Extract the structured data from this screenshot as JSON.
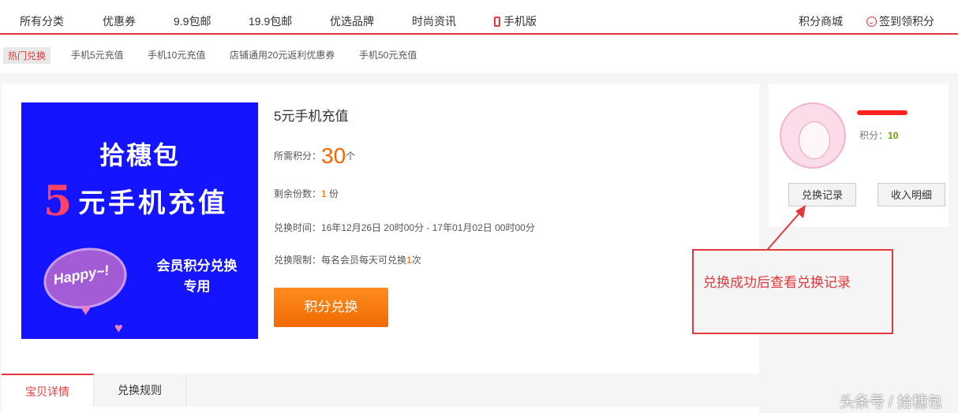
{
  "topnav": {
    "items": [
      "所有分类",
      "优惠券",
      "9.9包邮",
      "19.9包邮",
      "优选品牌",
      "时尚资讯"
    ],
    "mobile": "手机版",
    "points_mall": "积分商城",
    "signin": "签到领积分"
  },
  "subnav": {
    "items": [
      "热门兑换",
      "手机5元充值",
      "手机10元充值",
      "店铺通用20元返利优惠券",
      "手机50元充值"
    ]
  },
  "product": {
    "image_text": {
      "line1": "拾穗包",
      "line2_num": "5",
      "line2": "元手机充值",
      "line3": "会员积分兑换",
      "line4": "专用",
      "bubble": "Happy~!"
    },
    "title": "5元手机充值",
    "points_label": "所需积分：",
    "points_value": "30",
    "points_unit": "个",
    "remaining_label": "剩余份数：",
    "remaining_value": "1",
    "remaining_unit": " 份",
    "time_label": "兑换时间：",
    "time_value": "16年12月26日 20时00分 - 17年01月02日 00时00分",
    "limit_label": "兑换限制：",
    "limit_pre": "每名会员每天可兑换",
    "limit_num": "1",
    "limit_post": "次",
    "redeem_button": "积分兑换"
  },
  "tabs": [
    "宝贝详情",
    "兑换规则"
  ],
  "sidebar": {
    "score_label": "积分：",
    "score_value": "10",
    "history_button": "兑换记录",
    "income_button": "收入明细"
  },
  "annotation": {
    "text": "兑换成功后查看兑换记录"
  },
  "watermark": "头条号 / 拾穗包",
  "colors": {
    "accent": "#e4393c",
    "orange": "#f56600",
    "product_bg": "#1414ff",
    "score_green": "#67a300"
  }
}
